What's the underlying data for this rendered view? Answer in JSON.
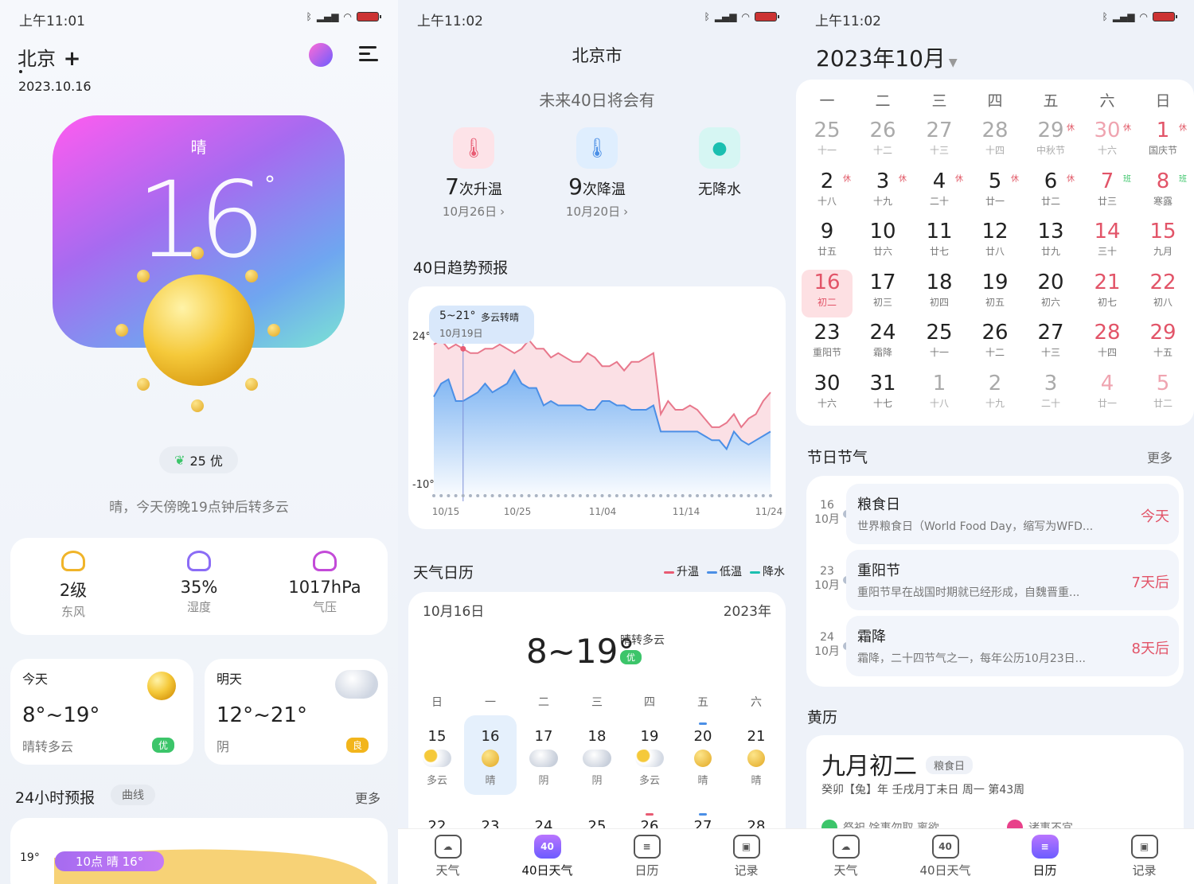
{
  "panel1": {
    "status_time": "上午11:01",
    "city": "北京",
    "date": "2023.10.16",
    "condition": "晴",
    "temperature": "16",
    "degree": "°",
    "aqi": "25 优",
    "summary": "晴，今天傍晚19点钟后转多云",
    "metrics": [
      {
        "value": "2级",
        "label": "东风",
        "icon": "wind-icon",
        "color": "#f0b429"
      },
      {
        "value": "35%",
        "label": "湿度",
        "icon": "humidity-icon",
        "color": "#8b6cf6"
      },
      {
        "value": "1017hPa",
        "label": "气压",
        "icon": "pressure-icon",
        "color": "#c34ad8"
      }
    ],
    "today": {
      "title": "今天",
      "range": "8°~19°",
      "desc": "晴转多云",
      "badge": "优",
      "badge_color": "#3cc56a"
    },
    "tomorrow": {
      "title": "明天",
      "range": "12°~21°",
      "desc": "阴",
      "badge": "良",
      "badge_color": "#f2b51c"
    },
    "hourly_title": "24小时预报",
    "hourly_mode": "曲线",
    "hourly_more": "更多",
    "hourly_temp": "19°",
    "hourly_pill": "10点 晴 16°"
  },
  "panel2": {
    "status_time": "上午11:02",
    "city": "北京市",
    "future_title": "未来40日将会有",
    "stats": [
      {
        "num": "7",
        "unit": "次升温",
        "date": "10月26日",
        "icon": "temp-up-icon",
        "bg": "#fde3e8",
        "fg": "#e85b73"
      },
      {
        "num": "9",
        "unit": "次降温",
        "date": "10月20日",
        "icon": "temp-down-icon",
        "bg": "#dfeefe",
        "fg": "#4b8fe6"
      },
      {
        "num": "",
        "unit": "无降水",
        "date": "",
        "icon": "water-drop-icon",
        "bg": "#d6f6f3",
        "fg": "#1bbfb0"
      }
    ],
    "trend_title": "40日趋势预报",
    "trend_tip_temp": "5~21°",
    "trend_tip_cond": "多云转晴",
    "trend_tip_date": "10月19日",
    "cal_title": "天气日历",
    "legend": [
      {
        "label": "升温",
        "color": "#e85b73"
      },
      {
        "label": "低温",
        "color": "#4b8fe6"
      },
      {
        "label": "降水",
        "color": "#1bbfb0"
      }
    ],
    "cal_date": "10月16日",
    "cal_year": "2023年",
    "cal_range": "8~19°",
    "cal_cond": "晴转多云",
    "cal_badge": "优",
    "weekdays": [
      "日",
      "一",
      "二",
      "三",
      "四",
      "五",
      "六"
    ],
    "days": [
      {
        "d": "15",
        "w": "多云",
        "i": "partly-cloudy-icon"
      },
      {
        "d": "16",
        "w": "晴",
        "i": "sun-icon"
      },
      {
        "d": "17",
        "w": "阴",
        "i": "cloud-icon"
      },
      {
        "d": "18",
        "w": "阴",
        "i": "cloud-icon"
      },
      {
        "d": "19",
        "w": "多云",
        "i": "partly-cloudy-icon"
      },
      {
        "d": "20",
        "w": "晴",
        "i": "sun-icon"
      },
      {
        "d": "21",
        "w": "晴",
        "i": "sun-icon"
      }
    ],
    "next_days": [
      "22",
      "23",
      "24",
      "25",
      "26",
      "27",
      "28"
    ],
    "tabs": [
      {
        "label": "天气",
        "glyph": "☁"
      },
      {
        "label": "40日天气",
        "glyph": "40"
      },
      {
        "label": "日历",
        "glyph": "≡"
      },
      {
        "label": "记录",
        "glyph": "▣"
      }
    ]
  },
  "chart_data": {
    "type": "area",
    "title": "40日趋势预报",
    "x_ticks": [
      "10/15",
      "10/25",
      "11/04",
      "11/14",
      "11/24"
    ],
    "y_ticks": [
      "24°",
      "-10°"
    ],
    "series": [
      {
        "name": "升温",
        "values": [
          22,
          23,
          21,
          22,
          21,
          20,
          20,
          21,
          21,
          22,
          21,
          20,
          21,
          23,
          21,
          21,
          19,
          20,
          19,
          18,
          18,
          20,
          19,
          17,
          17,
          18,
          16,
          18,
          18,
          19,
          20,
          6,
          9,
          7,
          7,
          8,
          7,
          5,
          3,
          3,
          4,
          6,
          3,
          5,
          6,
          9,
          11
        ]
      },
      {
        "name": "低温",
        "values": [
          10,
          13,
          14,
          9,
          9,
          10,
          11,
          13,
          11,
          12,
          13,
          16,
          13,
          12,
          12,
          8,
          9,
          8,
          8,
          8,
          8,
          7,
          7,
          9,
          9,
          8,
          8,
          7,
          7,
          7,
          8,
          2,
          2,
          2,
          2,
          2,
          2,
          1,
          0,
          0,
          -2,
          2,
          0,
          -1,
          0,
          1,
          2
        ]
      }
    ],
    "ylim": [
      -14,
      28
    ]
  },
  "panel3": {
    "status_time": "上午11:02",
    "month": "2023年10月",
    "weekdays": [
      "一",
      "二",
      "三",
      "四",
      "五",
      "六",
      "日"
    ],
    "weeks": [
      [
        {
          "d": "25",
          "l": "十一",
          "c": "g"
        },
        {
          "d": "26",
          "l": "十二",
          "c": "g"
        },
        {
          "d": "27",
          "l": "十三",
          "c": "g"
        },
        {
          "d": "28",
          "l": "十四",
          "c": "g"
        },
        {
          "d": "29",
          "l": "中秋节",
          "c": "g",
          "t": "休"
        },
        {
          "d": "30",
          "l": "十六",
          "c": "gr",
          "t": "休"
        },
        {
          "d": "1",
          "l": "国庆节",
          "c": "r",
          "t": "休"
        }
      ],
      [
        {
          "d": "2",
          "l": "十八",
          "c": "n",
          "t": "休"
        },
        {
          "d": "3",
          "l": "十九",
          "c": "n",
          "t": "休"
        },
        {
          "d": "4",
          "l": "二十",
          "c": "n",
          "t": "休"
        },
        {
          "d": "5",
          "l": "廿一",
          "c": "n",
          "t": "休"
        },
        {
          "d": "6",
          "l": "廿二",
          "c": "n",
          "t": "休"
        },
        {
          "d": "7",
          "l": "廿三",
          "c": "r",
          "t": "班"
        },
        {
          "d": "8",
          "l": "寒露",
          "c": "r",
          "t": "班"
        }
      ],
      [
        {
          "d": "9",
          "l": "廿五",
          "c": "n"
        },
        {
          "d": "10",
          "l": "廿六",
          "c": "n"
        },
        {
          "d": "11",
          "l": "廿七",
          "c": "n"
        },
        {
          "d": "12",
          "l": "廿八",
          "c": "n"
        },
        {
          "d": "13",
          "l": "廿九",
          "c": "n"
        },
        {
          "d": "14",
          "l": "三十",
          "c": "r"
        },
        {
          "d": "15",
          "l": "九月",
          "c": "r"
        }
      ],
      [
        {
          "d": "16",
          "l": "初二",
          "c": "sel"
        },
        {
          "d": "17",
          "l": "初三",
          "c": "n"
        },
        {
          "d": "18",
          "l": "初四",
          "c": "n"
        },
        {
          "d": "19",
          "l": "初五",
          "c": "n"
        },
        {
          "d": "20",
          "l": "初六",
          "c": "n"
        },
        {
          "d": "21",
          "l": "初七",
          "c": "r"
        },
        {
          "d": "22",
          "l": "初八",
          "c": "r"
        }
      ],
      [
        {
          "d": "23",
          "l": "重阳节",
          "c": "n"
        },
        {
          "d": "24",
          "l": "霜降",
          "c": "n"
        },
        {
          "d": "25",
          "l": "十一",
          "c": "n"
        },
        {
          "d": "26",
          "l": "十二",
          "c": "n"
        },
        {
          "d": "27",
          "l": "十三",
          "c": "n"
        },
        {
          "d": "28",
          "l": "十四",
          "c": "r"
        },
        {
          "d": "29",
          "l": "十五",
          "c": "r"
        }
      ],
      [
        {
          "d": "30",
          "l": "十六",
          "c": "n"
        },
        {
          "d": "31",
          "l": "十七",
          "c": "n"
        },
        {
          "d": "1",
          "l": "十八",
          "c": "g"
        },
        {
          "d": "2",
          "l": "十九",
          "c": "g"
        },
        {
          "d": "3",
          "l": "二十",
          "c": "g"
        },
        {
          "d": "4",
          "l": "廿一",
          "c": "gr"
        },
        {
          "d": "5",
          "l": "廿二",
          "c": "gr"
        }
      ]
    ],
    "holiday_title": "节日节气",
    "holiday_more": "更多",
    "holidays": [
      {
        "day": "16",
        "month": "10月",
        "name": "粮食日",
        "desc": "世界粮食日（World Food Day，缩写为WFD...",
        "when": "今天"
      },
      {
        "day": "23",
        "month": "10月",
        "name": "重阳节",
        "desc": "重阳节早在战国时期就已经形成，自魏晋重...",
        "when": "7天后"
      },
      {
        "day": "24",
        "month": "10月",
        "name": "霜降",
        "desc": "霜降，二十四节气之一，每年公历10月23日...",
        "when": "8天后"
      }
    ],
    "almanac_title": "黄历",
    "lunar_date": "九月初二",
    "lunar_tag": "粮食日",
    "ganzhi": "癸卯【兔】年 壬戌月丁未日 周一 第43周",
    "yi": "祭祀 馀事勿取 离欲",
    "ji": "诸事不宜",
    "tabs": [
      {
        "label": "天气",
        "glyph": "☁"
      },
      {
        "label": "40日天气",
        "glyph": "40"
      },
      {
        "label": "日历",
        "glyph": "≡"
      },
      {
        "label": "记录",
        "glyph": "▣"
      }
    ]
  }
}
